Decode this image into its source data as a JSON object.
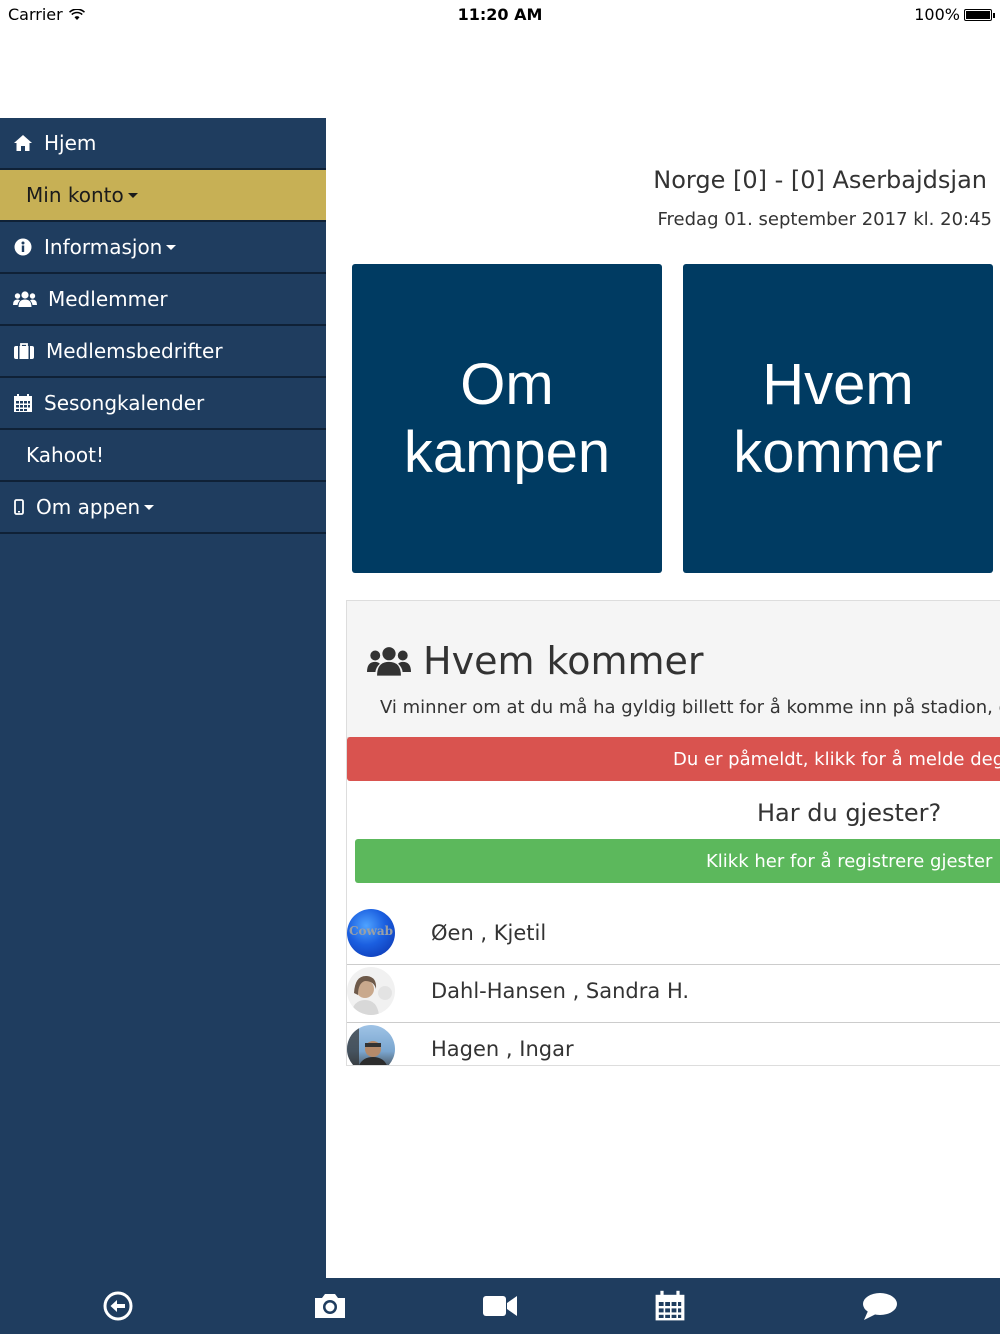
{
  "status_bar": {
    "carrier": "Carrier",
    "time": "11:20 AM",
    "battery": "100%"
  },
  "sidebar": {
    "items": [
      {
        "label": "Hjem",
        "icon": "home-icon"
      },
      {
        "label": "Min konto",
        "icon": "",
        "active": true,
        "dropdown": true
      },
      {
        "label": "Informasjon",
        "icon": "info-icon",
        "dropdown": true
      },
      {
        "label": "Medlemmer",
        "icon": "users-icon"
      },
      {
        "label": "Medlemsbedrifter",
        "icon": "briefcase-icon"
      },
      {
        "label": "Sesongkalender",
        "icon": "calendar-icon"
      },
      {
        "label": "Kahoot!",
        "icon": ""
      },
      {
        "label": "Om appen",
        "icon": "mobile-icon",
        "dropdown": true
      }
    ]
  },
  "match": {
    "title": "Norge [0] - [0] Aserbajdsjan",
    "date": "Fredag 01. september 2017 kl. 20:45"
  },
  "tiles": {
    "left": "Om\nkampen",
    "right": "Hvem\nkommer"
  },
  "attendance": {
    "title": "Hvem kommer",
    "title_icon": "users-icon",
    "note": "Vi minner om at du må ha gyldig billett for å komme inn på stadion, denn",
    "signoff_button": "Du er påmeldt, klikk for å melde deg av",
    "guests_question": "Har du gjester?",
    "guests_button": "Klikk her for å registrere gjester",
    "attendees": [
      {
        "name": "Øen , Kjetil",
        "avatar": "Cowab"
      },
      {
        "name": "Dahl-Hansen , Sandra H.",
        "avatar": ""
      },
      {
        "name": "Hagen , Ingar",
        "avatar": ""
      }
    ]
  },
  "tabbar": {
    "items": [
      "back-icon",
      "camera-icon",
      "video-icon",
      "calendar-icon",
      "chat-icon"
    ]
  },
  "colors": {
    "sidebar": "#1f3d5f",
    "active_item": "#c7b055",
    "tile": "#003b62",
    "danger": "#d9534f",
    "success": "#5cb85c"
  }
}
